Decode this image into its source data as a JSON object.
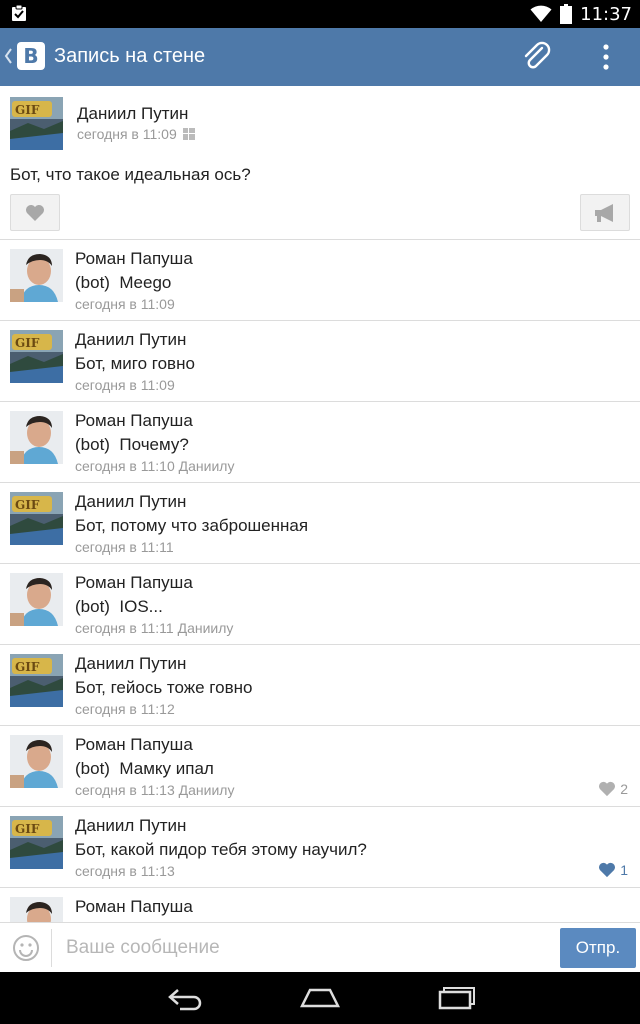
{
  "status_bar": {
    "time": "11:37"
  },
  "app_bar": {
    "logo_letter": "B",
    "title": "Запись на стене"
  },
  "post": {
    "author": "Даниил Путин",
    "time": "сегодня в 11:09",
    "text": "Бот, что такое идеальная ось?"
  },
  "comments": [
    {
      "author": "Роман Папуша",
      "text": "(bot)  Meego",
      "meta": "сегодня в 11:09",
      "avatar": "roman"
    },
    {
      "author": "Даниил Путин",
      "text": "Бот, миго говно",
      "meta": "сегодня в 11:09",
      "avatar": "daniil"
    },
    {
      "author": "Роман Папуша",
      "text": "(bot)  Почему?",
      "meta": "сегодня в 11:10 Даниилу",
      "avatar": "roman"
    },
    {
      "author": "Даниил Путин",
      "text": "Бот, потому что заброшенная",
      "meta": "сегодня в 11:11",
      "avatar": "daniil"
    },
    {
      "author": "Роман Папуша",
      "text": "(bot)  IOS...",
      "meta": "сегодня в 11:11 Даниилу",
      "avatar": "roman"
    },
    {
      "author": "Даниил Путин",
      "text": "Бот, гейось тоже говно",
      "meta": "сегодня в 11:12",
      "avatar": "daniil"
    },
    {
      "author": "Роман Папуша",
      "text": "(bot)  Мамку ипал",
      "meta": "сегодня в 11:13 Даниилу",
      "avatar": "roman",
      "likes": "2",
      "liked": false
    },
    {
      "author": "Даниил Путин",
      "text": "Бот, какой пидор тебя этому научил?",
      "meta": "сегодня в 11:13",
      "avatar": "daniil",
      "likes": "1",
      "liked": true
    },
    {
      "author": "Роман Папуша",
      "text": "",
      "meta": "",
      "avatar": "roman"
    }
  ],
  "input": {
    "placeholder": "Ваше сообщение",
    "value": "",
    "send_label": "Отпр."
  },
  "colors": {
    "header": "#4e79a9",
    "send_button": "#5b8ac0",
    "meta_text": "#999999",
    "liked": "#4e79a9"
  }
}
